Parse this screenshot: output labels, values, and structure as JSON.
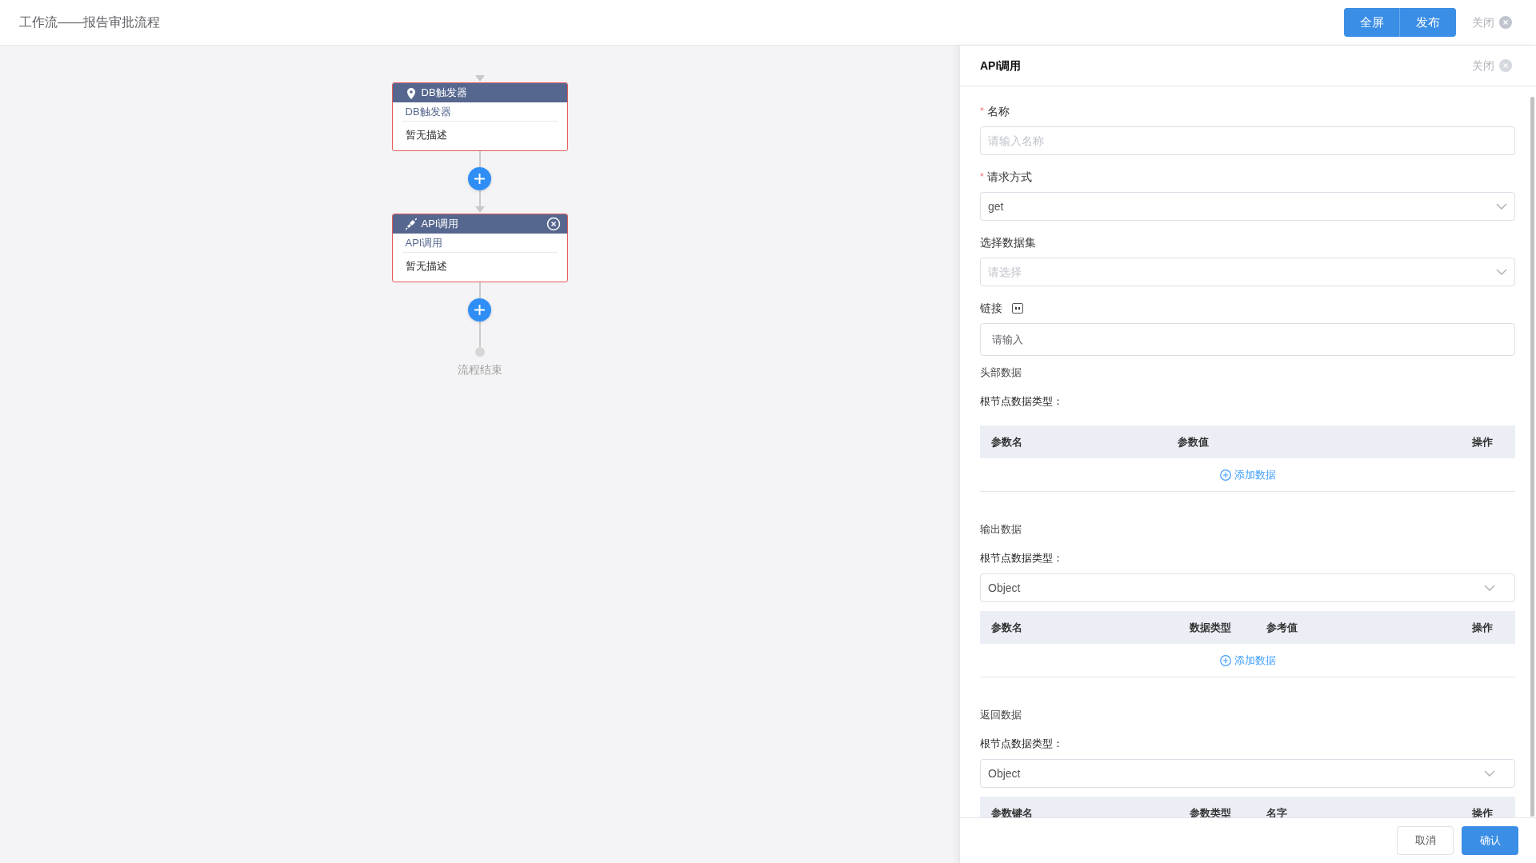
{
  "header": {
    "title": "工作流——报告审批流程",
    "buttons": [
      {
        "label": "全屏"
      },
      {
        "label": "发布"
      }
    ],
    "close": "关闭"
  },
  "flow": {
    "nodes": [
      {
        "kind": "trigger",
        "title": "DB触发器",
        "name": "DB触发器",
        "description": "暂无描述",
        "deletable": false
      },
      {
        "kind": "api",
        "title": "API调用",
        "name": "API调用",
        "description": "暂无描述",
        "deletable": true
      }
    ],
    "end_label": "流程结束"
  },
  "panel": {
    "title": "API调用",
    "close": "关闭",
    "fields": [
      {
        "kind": "input",
        "required_mark": "*",
        "label": "名称",
        "placeholder": "请输入名称"
      },
      {
        "kind": "select",
        "required_mark": "*",
        "label": "请求方式",
        "value": "get"
      },
      {
        "kind": "select",
        "label": "选择数据集",
        "placeholder": "请选择"
      },
      {
        "kind": "link",
        "label": "链接",
        "placeholder": "请输入"
      }
    ],
    "sections": [
      {
        "title": "头部数据",
        "root_type_label": "根节点数据类型：",
        "columns": [
          "参数名",
          "参数值",
          "操作"
        ],
        "add_label": "添加数据"
      },
      {
        "title": "输出数据",
        "root_type_label": "根节点数据类型：",
        "root_type": "Object",
        "columns": [
          "参数名",
          "数据类型",
          "参考值",
          "操作"
        ],
        "add_label": "添加数据"
      },
      {
        "title": "返回数据",
        "root_type_label": "根节点数据类型：",
        "root_type": "Object",
        "columns": [
          "参数键名",
          "参数类型",
          "名字",
          "操作"
        ]
      }
    ],
    "footer": {
      "cancel": "取消",
      "confirm": "确认"
    }
  }
}
